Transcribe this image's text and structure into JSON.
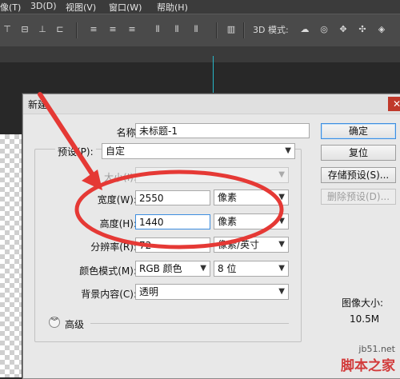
{
  "menubar": {
    "items": [
      "像(T)",
      "3D(D)",
      "视图(V)",
      "窗口(W)",
      "帮助(H)"
    ]
  },
  "toolbar": {
    "mode_3d_label": "3D 模式:",
    "icons": [
      "align-top-icon",
      "align-vcenter-icon",
      "align-bottom-icon",
      "align-left-icon",
      "align-hcenter-icon",
      "align-right-icon",
      "distribute-top-icon",
      "distribute-vcenter-icon",
      "distribute-bottom-icon",
      "distribute-left-icon",
      "distribute-hcenter-icon",
      "distribute-right-icon",
      "auto-align-icon"
    ],
    "icons_3d": [
      "orbit-icon",
      "roll-icon",
      "pan-icon",
      "slide-icon",
      "scale-icon"
    ]
  },
  "dialog": {
    "title": "新建",
    "name_label": "名称(N):",
    "name_value": "未标题-1",
    "preset_label": "预设(P):",
    "preset_value": "自定",
    "size_label": "大小(I):",
    "width_label": "宽度(W):",
    "width_value": "2550",
    "width_unit": "像素",
    "height_label": "高度(H):",
    "height_value": "1440",
    "height_unit": "像素",
    "resolution_label": "分辨率(R):",
    "resolution_value": "72",
    "resolution_unit": "像素/英寸",
    "color_mode_label": "颜色模式(M):",
    "color_mode_value": "RGB 颜色",
    "bit_depth_value": "8 位",
    "background_label": "背景内容(C):",
    "background_value": "透明",
    "advanced_label": "高级",
    "image_size_label": "图像大小:",
    "image_size_value": "10.5M",
    "buttons": {
      "ok": "确定",
      "reset": "复位",
      "save_preset": "存储预设(S)...",
      "delete_preset": "删除预设(D)..."
    }
  },
  "watermark": {
    "line1": "jb51.net",
    "line2": "脚本之家"
  },
  "colors": {
    "annotation_red": "#e53935",
    "guide_cyan": "#27b7c9",
    "dialog_bg": "#e8e8e8"
  }
}
